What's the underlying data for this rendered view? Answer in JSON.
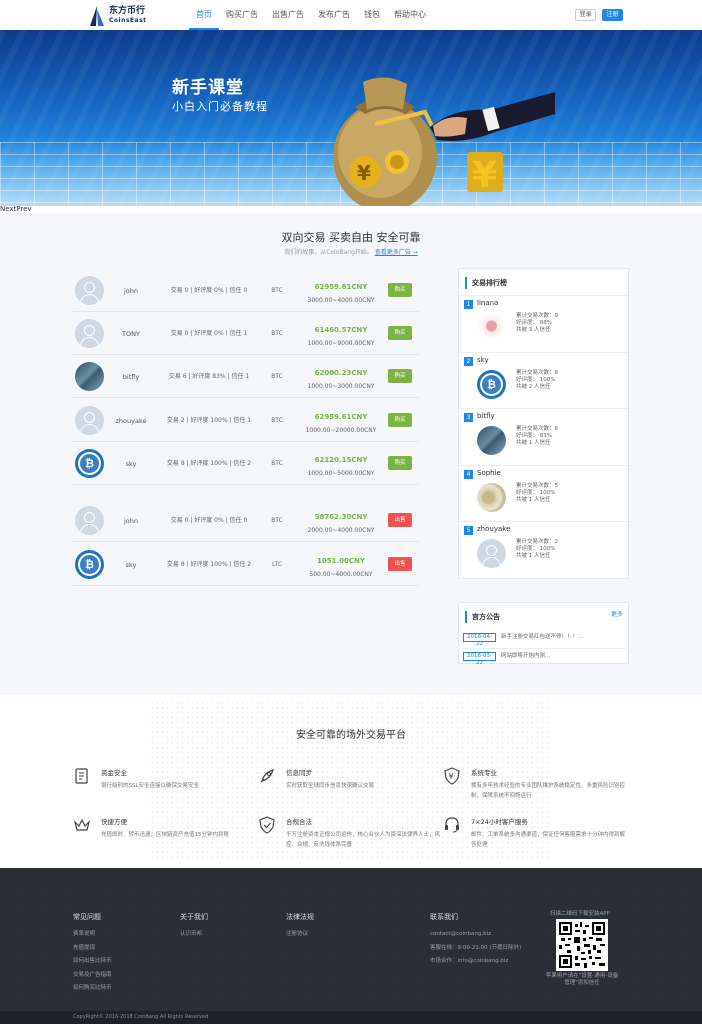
{
  "header": {
    "logo": {
      "title": "东方币行",
      "subtitle": "CoinsEast"
    },
    "nav": [
      "首页",
      "购买广告",
      "出售广告",
      "发布广告",
      "钱包",
      "帮助中心"
    ],
    "login": "登录",
    "register": "注册"
  },
  "banner": {
    "title": "新手课堂",
    "subtitle": "小白入门必备教程",
    "nextprev": "NextPrev"
  },
  "trading": {
    "title": "双向交易 买卖自由 安全可靠",
    "subtitle": "我们的故事，从CoinBang开始。",
    "link": "查看更多广告 →",
    "buy_rows": [
      {
        "user": "john",
        "stats": "交易 0 | 好评度 0% | 信任 0",
        "coin": "BTC",
        "price": "62959.61CNY",
        "range": "3000.00~4000.00CNY",
        "action": "购买",
        "avatar": "default"
      },
      {
        "user": "TONY",
        "stats": "交易 0 | 好评度 0% | 信任 1",
        "coin": "BTC",
        "price": "61460.57CNY",
        "range": "1000.00~9000.00CNY",
        "action": "购买",
        "avatar": "default"
      },
      {
        "user": "bitfly",
        "stats": "交易 6 | 好评度 83% | 信任 1",
        "coin": "BTC",
        "price": "62000.23CNY",
        "range": "1000.00~3000.00CNY",
        "action": "购买",
        "avatar": "photo"
      },
      {
        "user": "zhouyake",
        "stats": "交易 2 | 好评度 100% | 信任 1",
        "coin": "BTC",
        "price": "62959.61CNY",
        "range": "1000.00~20000.00CNY",
        "action": "购买",
        "avatar": "default"
      },
      {
        "user": "sky",
        "stats": "交易 8 | 好评度 100% | 信任 2",
        "coin": "BTC",
        "price": "62120.15CNY",
        "range": "1000.00~5000.00CNY",
        "action": "购买",
        "avatar": "btc"
      }
    ],
    "sell_rows": [
      {
        "user": "john",
        "stats": "交易 0 | 好评度 0% | 信任 0",
        "coin": "BTC",
        "price": "58762.30CNY",
        "range": "2000.00~4000.00CNY",
        "action": "出售",
        "avatar": "default"
      },
      {
        "user": "sky",
        "stats": "交易 8 | 好评度 100% | 信任 2",
        "coin": "LTC",
        "price": "1051.00CNY",
        "range": "500.00~4000.00CNY",
        "action": "出售",
        "avatar": "btc"
      }
    ]
  },
  "ranking": {
    "title": "交易排行榜",
    "items": [
      {
        "rank": "1",
        "name": "linana",
        "trades": "累计交易次数：9",
        "rate": "好评度：  88%",
        "trust": "共被 3 人信任",
        "avatar": "girl"
      },
      {
        "rank": "2",
        "name": "sky",
        "trades": "累计交易次数：8",
        "rate": "好评度：  100%",
        "trust": "共被 2 人信任",
        "avatar": "btc"
      },
      {
        "rank": "3",
        "name": "bitfly",
        "trades": "累计交易次数：6",
        "rate": "好评度：  83%",
        "trust": "共被 1 人信任",
        "avatar": "photo"
      },
      {
        "rank": "4",
        "name": "Sophie",
        "trades": "累计交易次数：5",
        "rate": "好评度：  100%",
        "trust": "共被 1 人信任",
        "avatar": "cat"
      },
      {
        "rank": "5",
        "name": "zhouyake",
        "trades": "累计交易次数：2",
        "rate": "好评度：  100%",
        "trust": "共被 1 人信任",
        "avatar": "default"
      }
    ]
  },
  "notice": {
    "title": "官方公告",
    "more": "更多",
    "items": [
      {
        "date": "2018-04-22",
        "text": "新手注册交易红包送不停！！！..."
      },
      {
        "date": "2018-03-22",
        "text": "网站即将开始内测..."
      }
    ]
  },
  "features": {
    "title": "安全可靠的场外交易平台",
    "items": [
      {
        "icon": "document-icon",
        "title": "资金安全",
        "desc": "银行级别的SSL安全连接以确保交易安全"
      },
      {
        "icon": "rocket-icon",
        "title": "信息同步",
        "desc": "实时获取全球同步信息快速确认交易"
      },
      {
        "icon": "shield-yen-icon",
        "title": "系统专业",
        "desc": "拥有多年技术经验的专业团队维护系统稳定性、多重风险识别控制，保障系统不间断运行"
      },
      {
        "icon": "crown-icon",
        "title": "快捷方便",
        "desc": "充值即时、转币迅速，区块链资产充值15分钟内到账"
      },
      {
        "icon": "shield-check-icon",
        "title": "合规合法",
        "desc": "千万注册资本正规公司运作，核心合伙人为资深法律界人士，风控、合规、反洗钱体系完善"
      },
      {
        "icon": "headset-icon",
        "title": "7×24小时客户服务",
        "desc": "邮件、工单系统多沟通渠道，保证任何客服需求十分钟内得到解答处理"
      }
    ]
  },
  "footer": {
    "cols": [
      {
        "title": "常见问题",
        "links": [
          "费率说明",
          "充值提现",
          "如何出售比特币",
          "交易及广告指南",
          "如何购买比特币"
        ]
      },
      {
        "title": "关于我们",
        "links": [
          "认识币邦"
        ]
      },
      {
        "title": "法律法规",
        "links": [
          "注册协议"
        ]
      },
      {
        "title": "联系我们",
        "links": [
          "contact@coinbang.biz",
          "客服在线：9:00-21:00 (节假日除外)",
          "市场合作：info@coinbang.biz"
        ]
      }
    ],
    "qr_title": "扫描二维码下载安装APP",
    "qr_note": "苹果用户请在\"设置-通用-设备管理\"添加信任",
    "copyright": "CopyRight© 2016-2018 CoinBang All Rights Reserved"
  }
}
